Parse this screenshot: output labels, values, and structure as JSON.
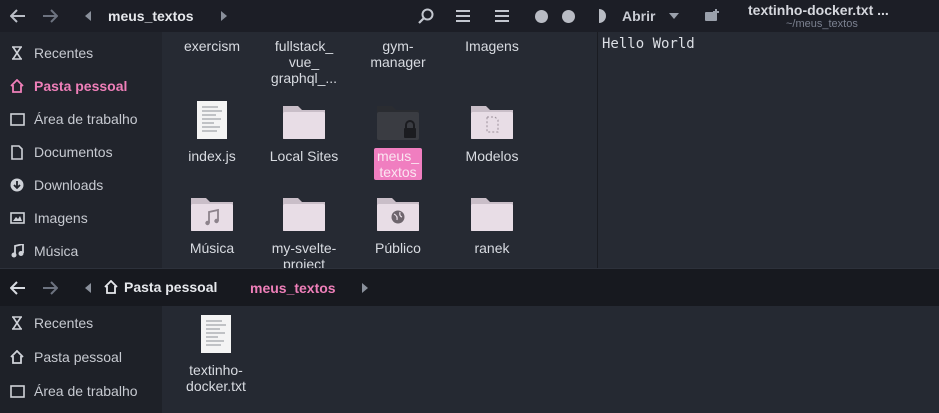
{
  "top_window": {
    "location": "meus_textos",
    "open_label": "Abrir",
    "editor_title": "textinho-docker.txt ...",
    "editor_subtitle": "~/meus_textos",
    "editor_content": "Hello World",
    "sidebar": [
      {
        "label": "Recentes",
        "icon": "clock-icon"
      },
      {
        "label": "Pasta pessoal",
        "icon": "home-icon",
        "active": true
      },
      {
        "label": "Área de trabalho",
        "icon": "desktop-icon"
      },
      {
        "label": "Documentos",
        "icon": "document-icon"
      },
      {
        "label": "Downloads",
        "icon": "download-icon"
      },
      {
        "label": "Imagens",
        "icon": "image-icon"
      },
      {
        "label": "Música",
        "icon": "music-icon"
      }
    ],
    "files": [
      {
        "name": "exercism"
      },
      {
        "name": "fullstack_\nvue_\ngraphql_..."
      },
      {
        "name": "gym-\nmanager"
      },
      {
        "name": "Imagens"
      },
      {
        "name": "index.js",
        "type": "text-file"
      },
      {
        "name": "Local Sites",
        "type": "folder"
      },
      {
        "name": "meus_\ntextos",
        "type": "locked-folder",
        "selected": true
      },
      {
        "name": "Modelos",
        "type": "template-folder"
      },
      {
        "name": "Música",
        "type": "music-folder"
      },
      {
        "name": "my-svelte-\nproject",
        "type": "folder"
      },
      {
        "name": "Público",
        "type": "public-folder"
      },
      {
        "name": "ranek",
        "type": "folder"
      }
    ]
  },
  "bottom_window": {
    "breadcrumb_home": "Pasta pessoal",
    "breadcrumb_current": "meus_textos",
    "sidebar": [
      {
        "label": "Recentes",
        "icon": "clock-icon"
      },
      {
        "label": "Pasta pessoal",
        "icon": "home-icon"
      },
      {
        "label": "Área de trabalho",
        "icon": "desktop-icon"
      }
    ],
    "files": [
      {
        "name": "textinho-\ndocker.txt",
        "type": "text-file"
      }
    ]
  },
  "colors": {
    "accent": "#ef7fb9",
    "background": "#262a33",
    "folder": "#e8dde6"
  }
}
